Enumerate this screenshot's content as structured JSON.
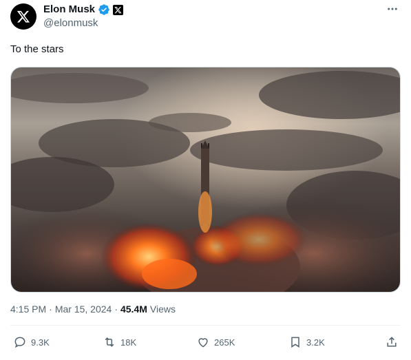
{
  "author": {
    "display_name": "Elon Musk",
    "handle": "@elonmusk"
  },
  "tweet": {
    "text": "To the stars"
  },
  "meta": {
    "time": "4:15 PM",
    "separator1": "·",
    "date": "Mar 15, 2024",
    "separator2": "·",
    "views_count": "45.4M",
    "views_label": "Views"
  },
  "actions": {
    "replies": "9.3K",
    "reposts": "18K",
    "likes": "265K",
    "bookmarks": "3.2K"
  },
  "colors": {
    "verified_blue": "#1d9bf0",
    "text_secondary": "#536471",
    "text_primary": "#0f1419"
  }
}
